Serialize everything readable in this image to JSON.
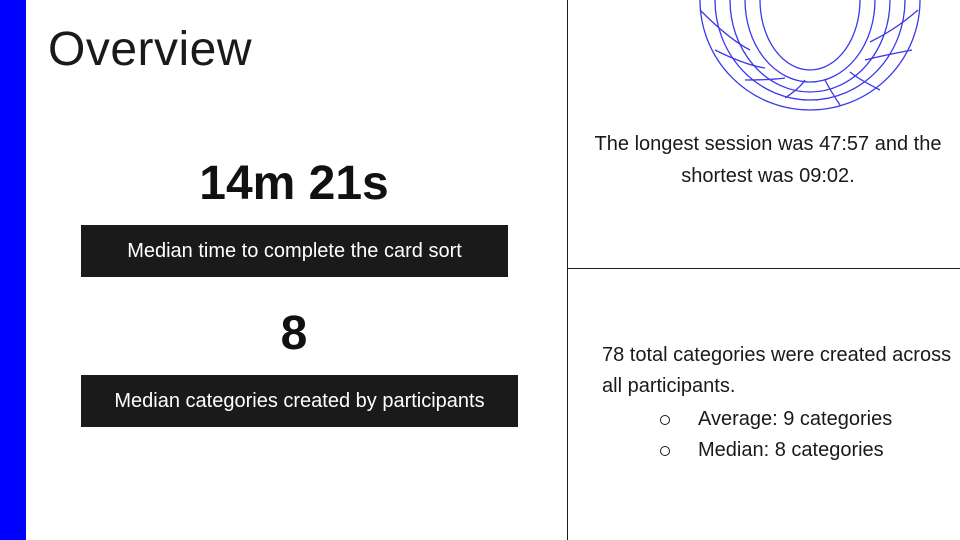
{
  "slide": {
    "title": "Overview",
    "accent_color": "#0000ff"
  },
  "left": {
    "time_stat": {
      "value": "14m 21s",
      "label": "Median time to complete the card sort"
    },
    "category_stat": {
      "value": "8",
      "label": "Median categories created by participants"
    }
  },
  "right": {
    "graphic_icon": "wireframe-torus-icon",
    "session_text": "The longest session was 47:57 and the shortest was 09:02.",
    "categories_text": "78 total categories were created across all participants.",
    "bullets": [
      "Average: 9 categories",
      "Median: 8 categories"
    ]
  }
}
